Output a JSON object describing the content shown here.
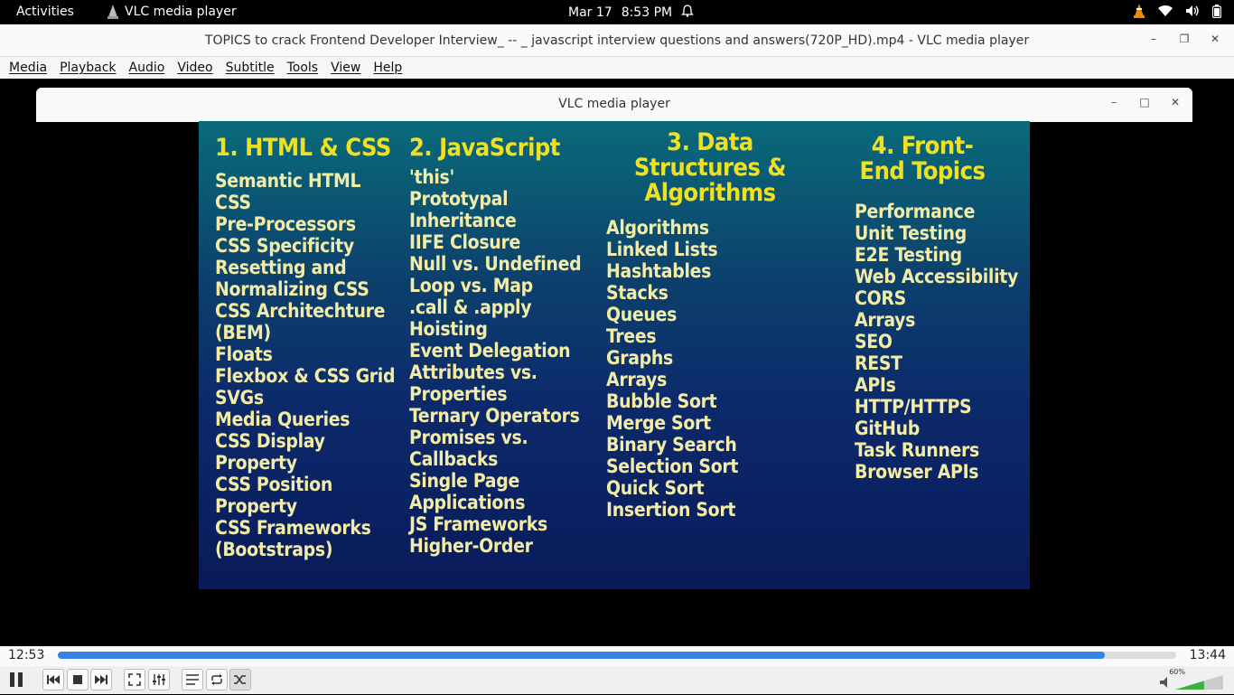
{
  "topbar": {
    "activities": "Activities",
    "app_name": "VLC media player",
    "date": "Mar 17",
    "time": "8:53 PM"
  },
  "window": {
    "title": "TOPICS to crack Frontend Developer Interview_ -- _ javascript interview questions and answers(720P_HD).mp4 - VLC media player"
  },
  "menu": [
    "Media",
    "Playback",
    "Audio",
    "Video",
    "Subtitle",
    "Tools",
    "View",
    "Help"
  ],
  "popup": {
    "title": "VLC media player"
  },
  "slide": {
    "columns": [
      {
        "heading": "1. HTML & CSS",
        "items": [
          "Semantic HTML",
          "CSS",
          "Pre-Processors",
          "CSS Specificity",
          "Resetting and",
          "Normalizing CSS",
          "CSS Architechture",
          "(BEM)",
          "Floats",
          "Flexbox & CSS Grid",
          "SVGs",
          "Media Queries",
          "CSS Display",
          "Property",
          "CSS Position",
          "Property",
          "CSS Frameworks",
          "(Bootstraps)"
        ]
      },
      {
        "heading": "2. JavaScript",
        "items": [
          "'this'",
          "Prototypal",
          "Inheritance",
          "IIFE Closure",
          "Null vs. Undefined",
          "Loop vs. Map",
          ".call & .apply",
          "Hoisting",
          "Event Delegation",
          "Attributes vs.",
          "Properties",
          "Ternary Operators",
          "Promises vs.",
          "Callbacks",
          "Single Page",
          "Applications",
          "JS Frameworks",
          "Higher-Order"
        ]
      },
      {
        "heading": "3. Data Structures & Algorithms",
        "items": [
          "Algorithms",
          "Linked Lists",
          "Hashtables",
          "Stacks",
          "Queues",
          "Trees",
          "Graphs",
          "Arrays",
          "Bubble Sort",
          "Merge Sort",
          "Binary Search",
          "Selection Sort",
          "Quick Sort",
          "Insertion Sort"
        ]
      },
      {
        "heading": "4. Front-End Topics",
        "items": [
          "Performance",
          "Unit Testing",
          "E2E Testing",
          "Web Accessibility",
          "CORS",
          "Arrays",
          "SEO",
          "REST",
          "APIs",
          "HTTP/HTTPS",
          "GitHub",
          "Task Runners",
          "Browser APIs"
        ]
      }
    ]
  },
  "player": {
    "elapsed": "12:53",
    "total": "13:44",
    "progress_fraction": 0.936,
    "volume": "60%",
    "volume_fraction": 0.6
  }
}
